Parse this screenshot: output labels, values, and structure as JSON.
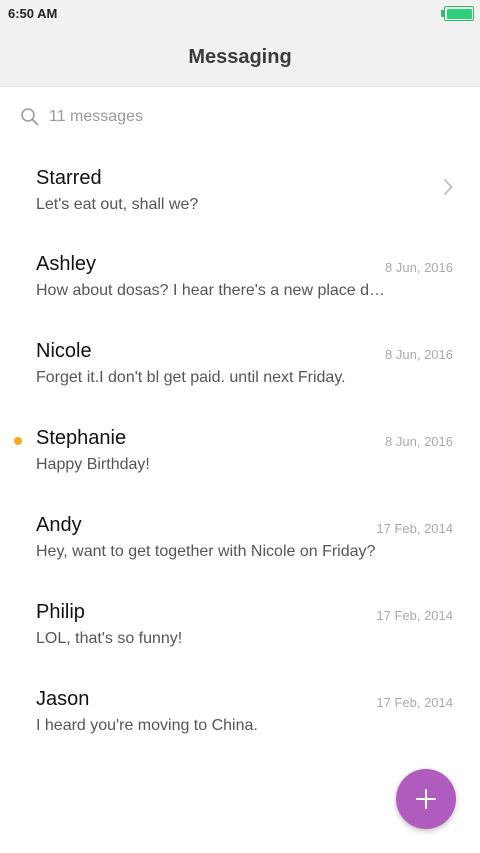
{
  "status_bar": {
    "time": "6:50 AM",
    "battery_icon": "battery-full-icon",
    "battery_color": "#2fce7c"
  },
  "header": {
    "title": "Messaging"
  },
  "search": {
    "icon": "search-icon",
    "label": "11 messages"
  },
  "conversations": [
    {
      "name": "Starred",
      "preview": "Let's eat out, shall we?",
      "date": "",
      "unread": false,
      "chevron": true
    },
    {
      "name": "Ashley",
      "preview": "How about dosas? I hear there's a new place downtown",
      "date": "8 Jun, 2016",
      "unread": false
    },
    {
      "name": "Nicole",
      "preview": "Forget it.I don't bl get paid. until next Friday.",
      "date": "8 Jun, 2016",
      "unread": false
    },
    {
      "name": "Stephanie",
      "preview": "Happy Birthday!",
      "date": "8 Jun, 2016",
      "unread": true
    },
    {
      "name": "Andy",
      "preview": "Hey, want to get together with Nicole on Friday?",
      "date": "17 Feb, 2014",
      "unread": false
    },
    {
      "name": "Philip",
      "preview": "LOL, that's so funny!",
      "date": "17 Feb, 2014",
      "unread": false
    },
    {
      "name": "Jason",
      "preview": "I heard you're moving to China.",
      "date": "17 Feb, 2014",
      "unread": false
    }
  ],
  "fab": {
    "icon": "plus-icon",
    "color": "#b05cbf"
  },
  "colors": {
    "unread_dot": "#f5a623"
  }
}
